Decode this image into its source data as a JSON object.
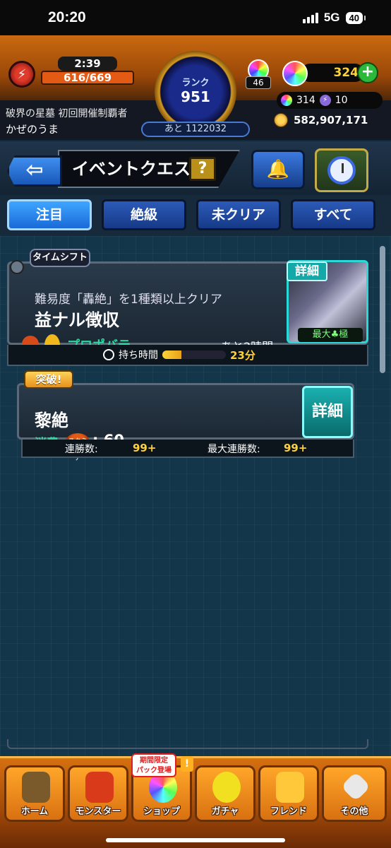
{
  "status_bar": {
    "time": "20:20",
    "network": "5G",
    "battery": "40"
  },
  "header": {
    "stamina_timer": "2:39",
    "stamina": "616/669",
    "rank_label": "ランク",
    "rank_value": "951",
    "next_exp": "あと 1122032",
    "hunter_level": "46",
    "orbs": "324",
    "sub_orbs": "314",
    "bolts": "10",
    "coins": "582,907,171",
    "title": "破界の星墓 初回開催制覇者",
    "player_name": "かぜのうま"
  },
  "nav": {
    "back_label": "⇦",
    "screen_title": "イベントクエスト",
    "help_label": "?"
  },
  "tabs": [
    {
      "label": "注目"
    },
    {
      "label": "絶級"
    },
    {
      "label": "未クリア"
    },
    {
      "label": "すべて"
    }
  ],
  "quests": [
    {
      "tag": "タイムシフト",
      "condition": "難易度「轟絶」を1種類以上クリア",
      "name": "益ナル徴収",
      "element": "プロポバテ",
      "time_left": "あと2時間",
      "detail_label": "詳細",
      "max_label": "最大♣極",
      "hold_label": "持ち時間",
      "hold_value": "23分",
      "hold_fraction": 0.3
    },
    {
      "tag": "突破!",
      "name": "黎絶",
      "consume_label": "消費",
      "stamina_icon_label": "スタミナ",
      "consume_value": ": 60",
      "detail_label": "詳細",
      "streak_label": "連勝数:",
      "streak_value": "99+",
      "max_streak_label": "最大連勝数:",
      "max_streak_value": "99+"
    }
  ],
  "bottom_nav": [
    {
      "label": "ホーム",
      "icon": "home-gate-icon"
    },
    {
      "label": "モンスター",
      "icon": "dragon-icon"
    },
    {
      "label": "ショップ",
      "icon": "rainbow-orb-icon"
    },
    {
      "label": "ガチャ",
      "icon": "gacha-egg-icon"
    },
    {
      "label": "フレンド",
      "icon": "friends-icon"
    },
    {
      "label": "その他",
      "icon": "more-icon"
    }
  ],
  "shop_badge": "期間限定\nパック登場",
  "shop_excl": "!"
}
